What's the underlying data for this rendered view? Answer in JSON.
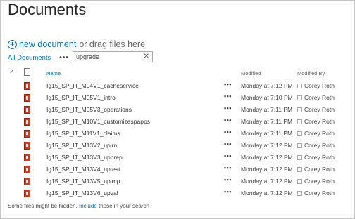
{
  "page": {
    "title": "Documents"
  },
  "toolbar": {
    "new_document_label": "new document",
    "drag_text": "or drag files here"
  },
  "views": {
    "current": "All Documents",
    "more_label": "•••"
  },
  "search": {
    "value": "upgrade",
    "clear_label": "✕"
  },
  "columns": {
    "check": "✓",
    "name": "Name",
    "modified": "Modified",
    "modified_by": "Modified By"
  },
  "rows": [
    {
      "name": "Ig15_SP_IT_M04V1_cacheservice",
      "modified": "Monday at 7:12 PM",
      "modified_by": "Corey Roth"
    },
    {
      "name": "Ig15_SP_IT_M05V1_intro",
      "modified": "Monday at 7:10 PM",
      "modified_by": "Corey Roth"
    },
    {
      "name": "Ig15_SP_IT_M05V3_operations",
      "modified": "Monday at 7:11 PM",
      "modified_by": "Corey Roth"
    },
    {
      "name": "Ig15_SP_IT_M10V1_customizespapps",
      "modified": "Monday at 7:11 PM",
      "modified_by": "Corey Roth"
    },
    {
      "name": "Ig15_SP_IT_M11V1_claims",
      "modified": "Monday at 7:11 PM",
      "modified_by": "Corey Roth"
    },
    {
      "name": "Ig15_SP_IT_M13V2_uplrn",
      "modified": "Monday at 7:12 PM",
      "modified_by": "Corey Roth"
    },
    {
      "name": "Ig15_SP_IT_M13V3_upprep",
      "modified": "Monday at 7:12 PM",
      "modified_by": "Corey Roth"
    },
    {
      "name": "Ig15_SP_IT_M13V4_uptest",
      "modified": "Monday at 7:12 PM",
      "modified_by": "Corey Roth"
    },
    {
      "name": "Ig15_SP_IT_M13V5_upimp",
      "modified": "Monday at 7:12 PM",
      "modified_by": "Corey Roth"
    },
    {
      "name": "Ig15_SP_IT_M13V6_upval",
      "modified": "Monday at 7:12 PM",
      "modified_by": "Corey Roth"
    }
  ],
  "row_more_label": "•••",
  "footer": {
    "prefix": "Some files might be hidden.",
    "link": "Include",
    "suffix": "these in your search"
  },
  "colors": {
    "accent": "#0072c6",
    "file_icon": "#c93e26"
  },
  "icons": {
    "new_document": "plus-circle-icon",
    "file": "powerpoint-file-icon",
    "header_doc": "document-icon",
    "presence": "presence-icon"
  }
}
